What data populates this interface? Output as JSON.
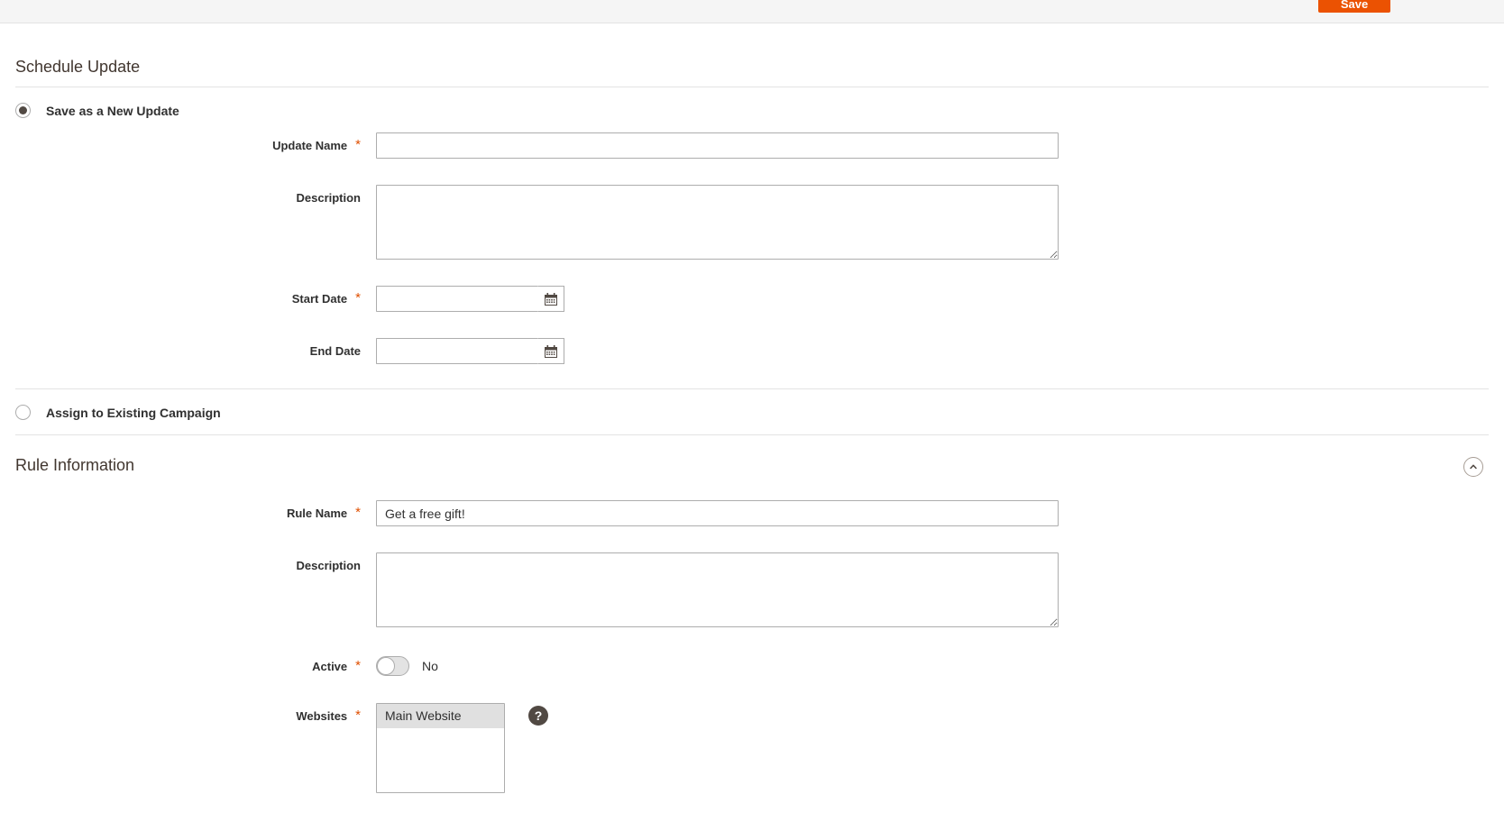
{
  "toolbar": {
    "save_label": "Save"
  },
  "schedule": {
    "title": "Schedule Update",
    "options": [
      {
        "label": "Save as a New Update",
        "selected": true
      },
      {
        "label": "Assign to Existing Campaign",
        "selected": false
      }
    ],
    "fields": {
      "update_name": {
        "label": "Update Name",
        "required": "*",
        "value": "",
        "placeholder": ""
      },
      "description": {
        "label": "Description",
        "value": "",
        "placeholder": ""
      },
      "start_date": {
        "label": "Start Date",
        "required": "*",
        "value": "",
        "placeholder": "",
        "icon": "calendar-icon"
      },
      "end_date": {
        "label": "End Date",
        "value": "",
        "placeholder": "",
        "icon": "calendar-icon"
      }
    }
  },
  "rule_information": {
    "title": "Rule Information",
    "collapse_icon": "chevron-up-icon",
    "fields": {
      "rule_name": {
        "label": "Rule Name",
        "required": "*",
        "value": "Get a free gift!",
        "placeholder": ""
      },
      "description": {
        "label": "Description",
        "value": "",
        "placeholder": ""
      },
      "active": {
        "label": "Active",
        "required": "*",
        "state_label": "No",
        "checked": false
      },
      "websites": {
        "label": "Websites",
        "required": "*",
        "options": [
          "Main Website"
        ],
        "selected": "Main Website",
        "help_icon": "question-mark-icon"
      }
    }
  },
  "colors": {
    "accent_orange": "#eb5202",
    "required_star": "#e04f00",
    "text": "#303030",
    "border": "#adadad",
    "divider": "#e3e3e3",
    "help_bg": "#514943"
  }
}
